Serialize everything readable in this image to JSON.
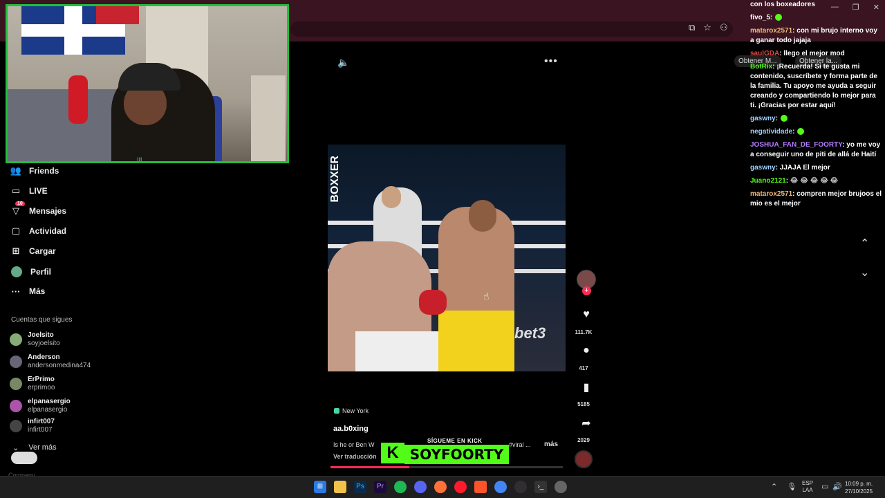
{
  "browser": {
    "obtain_chip_1": "Obtener M...",
    "obtain_chip_2": "Obtener la..."
  },
  "sidebar": {
    "items": [
      {
        "label": "Friends",
        "icon": "friends-icon"
      },
      {
        "label": "LIVE",
        "icon": "live-icon"
      },
      {
        "label": "Mensajes",
        "icon": "messages-icon",
        "badge": "10"
      },
      {
        "label": "Actividad",
        "icon": "activity-icon"
      },
      {
        "label": "Cargar",
        "icon": "upload-icon"
      },
      {
        "label": "Perfil",
        "icon": "profile-avatar"
      },
      {
        "label": "Más",
        "icon": "more-icon"
      }
    ],
    "following_header": "Cuentas que sigues",
    "following": [
      {
        "name": "Joelsito",
        "user": "soyjoelsito"
      },
      {
        "name": "Anderson",
        "user": "andersonmedina474"
      },
      {
        "name": "ErPrimo",
        "user": "erprimoo"
      },
      {
        "name": "elpanasergio",
        "user": "elpanasergio"
      },
      {
        "name": "infirt007",
        "user": "infirt007"
      }
    ],
    "see_more": "Ver más",
    "company": "Company"
  },
  "webcam": {
    "tag": "|||"
  },
  "video": {
    "location": "New York",
    "author": "aa.b0xing",
    "caption": "Is he or Ben W",
    "caption_tail": "#viral ...",
    "more": "más",
    "translate": "Ver traducción",
    "progress": 0.34,
    "brand_vertical": "BOXXER",
    "ad_text": "bet3"
  },
  "kick": {
    "subtitle": "SÍGUEME EN KICK",
    "logo": "K",
    "name": "SOYFOORTY"
  },
  "actions": {
    "likes": "111.7K",
    "comments": "417",
    "saves": "5185",
    "shares": "2029"
  },
  "chat": [
    {
      "user": "",
      "text": "con los boxeadores",
      "color": "#ffffff"
    },
    {
      "user": "fivo_5",
      "text": ":",
      "color": "#ffffff",
      "emote": true
    },
    {
      "user": "matarox2571",
      "text": ": con mi brujo interno voy a ganar todo jajaja",
      "color": "#f2b97c"
    },
    {
      "user": "saulGDA",
      "text": ": llego el mejor mod",
      "color": "#e04848"
    },
    {
      "user": "BotRix",
      "text": ": ¡Recuerda! Si te gusta mi contenido, suscríbete y forma parte de la familia. Tu apoyo me ayuda a seguir creando y compartiendo lo mejor para ti. ¡Gracias por estar aquí!",
      "color": "#53fc18"
    },
    {
      "user": "gaswny",
      "text": ":",
      "color": "#9fd0ff",
      "emote": true
    },
    {
      "user": "negatividade",
      "text": ":",
      "color": "#9fd0ff",
      "emote": true
    },
    {
      "user": "JOSHUA_FAN_DE_FOORTY",
      "text": ": yo me voy a conseguir uno de piti de allá de Haití",
      "color": "#b07cff"
    },
    {
      "user": "gaswny",
      "text": ": JJAJA El mejor",
      "color": "#9fd0ff"
    },
    {
      "user": "Juano2121",
      "text": ": 😂 😂 😂 😂 😂",
      "color": "#53fc18"
    },
    {
      "user": "matarox2571",
      "text": ": compren mejor brujoos el mio es el mejor",
      "color": "#f2b97c"
    }
  ],
  "taskbar": {
    "lang_top": "ESP",
    "lang_bottom": "LAA",
    "time": "10:09 p. m.",
    "date": "27/10/2025",
    "apps": [
      "windows-start",
      "file-explorer",
      "photoshop",
      "premiere",
      "spotify",
      "discord",
      "firefox",
      "opera",
      "brave",
      "chrome",
      "obs",
      "terminal",
      "settings"
    ]
  },
  "colors": {
    "kick_green": "#53fc18",
    "tiktok_red": "#fe2c55",
    "chrome_bar": "#3a1420"
  }
}
